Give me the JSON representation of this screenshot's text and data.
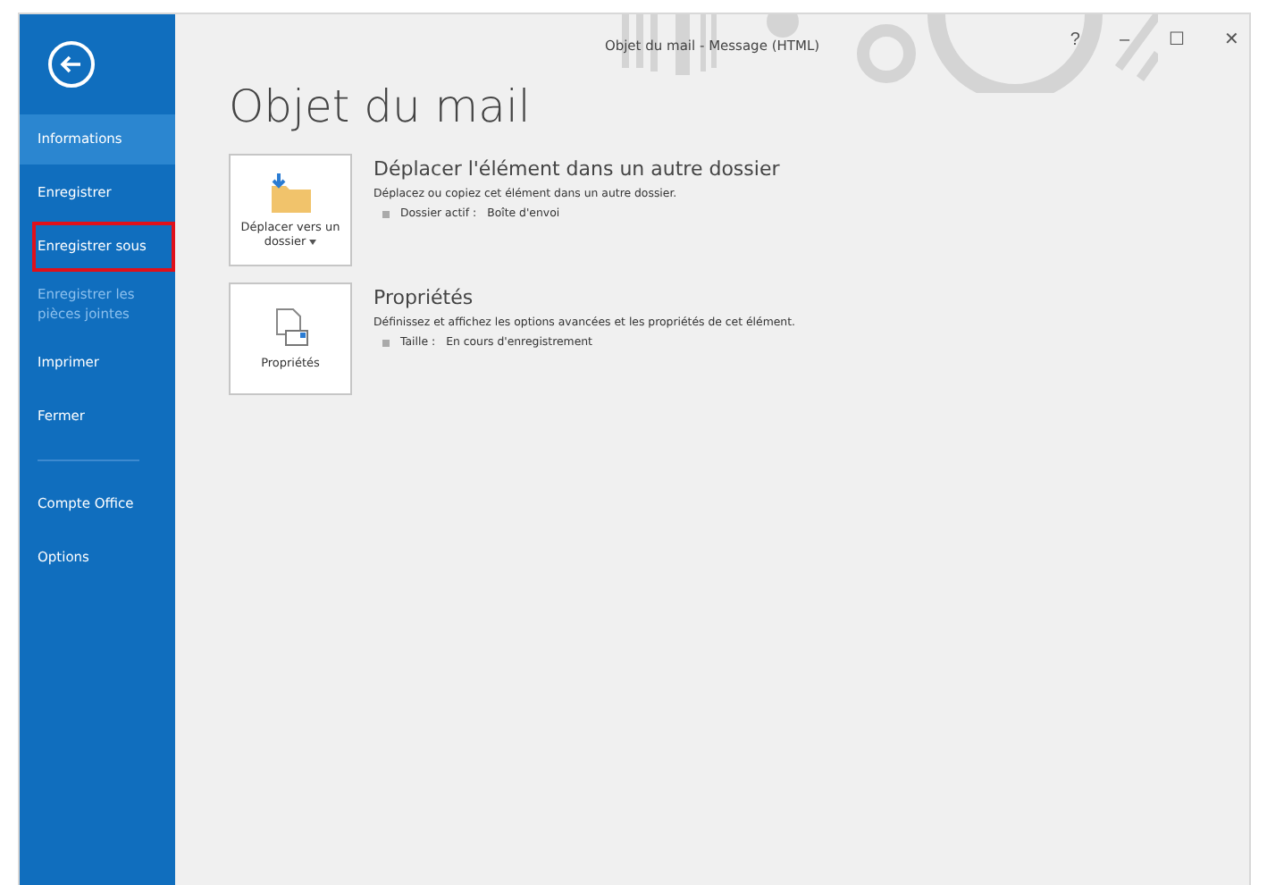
{
  "window": {
    "title": "Objet du mail - Message (HTML)",
    "controls": [
      "?",
      "–",
      "☐",
      "✕"
    ]
  },
  "sidebar": {
    "items": [
      {
        "kind": "item",
        "label": "Informations",
        "selected": true,
        "disabled": false,
        "highlighted": false
      },
      {
        "kind": "item",
        "label": "Enregistrer",
        "selected": false,
        "disabled": false,
        "highlighted": false
      },
      {
        "kind": "item",
        "label": "Enregistrer sous",
        "selected": false,
        "disabled": false,
        "highlighted": true
      },
      {
        "kind": "item",
        "label": "Enregistrer les pièces jointes",
        "selected": false,
        "disabled": true,
        "highlighted": false
      },
      {
        "kind": "item",
        "label": "Imprimer",
        "selected": false,
        "disabled": false,
        "highlighted": false
      },
      {
        "kind": "item",
        "label": "Fermer",
        "selected": false,
        "disabled": false,
        "highlighted": false
      },
      {
        "kind": "divider"
      },
      {
        "kind": "item",
        "label": "Compte Office",
        "selected": false,
        "disabled": false,
        "highlighted": false
      },
      {
        "kind": "item",
        "label": "Options",
        "selected": false,
        "disabled": false,
        "highlighted": false
      }
    ]
  },
  "page": {
    "heading": "Objet du mail",
    "sections": [
      {
        "kind": "move",
        "button": "Déplacer vers un dossier",
        "dropdown": true,
        "title": "Déplacer l'élément dans un autre dossier",
        "description": "Déplacez ou copiez cet élément dans un autre dossier.",
        "detail_label": "Dossier actif :",
        "detail_value": "Boîte d'envoi"
      },
      {
        "kind": "properties",
        "button": "Propriétés",
        "dropdown": false,
        "title": "Propriétés",
        "description": "Définissez et affichez les options avancées et les propriétés de cet élément.",
        "detail_label": "Taille :",
        "detail_value": "En cours d'enregistrement"
      }
    ]
  }
}
